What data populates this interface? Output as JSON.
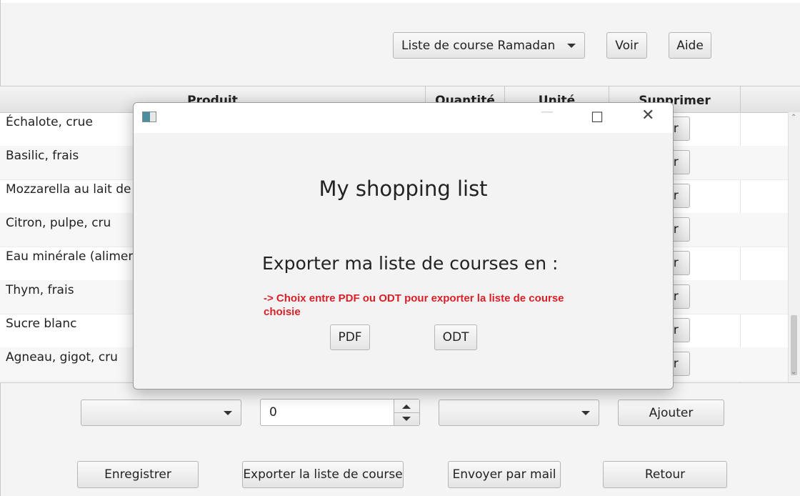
{
  "toolbar": {
    "list_select": "Liste de course Ramadan",
    "voir": "Voir",
    "aide": "Aide"
  },
  "table": {
    "columns": [
      "Produit",
      "Quantité",
      "Unité",
      "Supprimer"
    ],
    "delete_label": "er",
    "rows": [
      "Échalote, crue",
      "Basilic, frais",
      "Mozzarella au lait de v",
      "Citron, pulpe, cru",
      "Eau minérale (aliment",
      "Thym, frais",
      "Sucre blanc",
      "Agneau, gigot, cru"
    ]
  },
  "dialog": {
    "heading": "My shopping list",
    "export_label": "Exporter ma liste de courses en :",
    "hint": "-> Choix entre PDF ou ODT pour exporter la liste de course choisie",
    "pdf": "PDF",
    "odt": "ODT",
    "window_icons": [
      "app-icon",
      "minimize-icon",
      "maximize-icon",
      "close-icon"
    ]
  },
  "add_bar": {
    "product_select": "",
    "quantity": "0",
    "unit_select": "",
    "add": "Ajouter"
  },
  "footer": {
    "save": "Enregistrer",
    "export": "Exporter la liste de course",
    "mail": "Envoyer par mail",
    "back": "Retour"
  },
  "colors": {
    "hint_red": "#d92027",
    "background": "#f4f4f4"
  }
}
